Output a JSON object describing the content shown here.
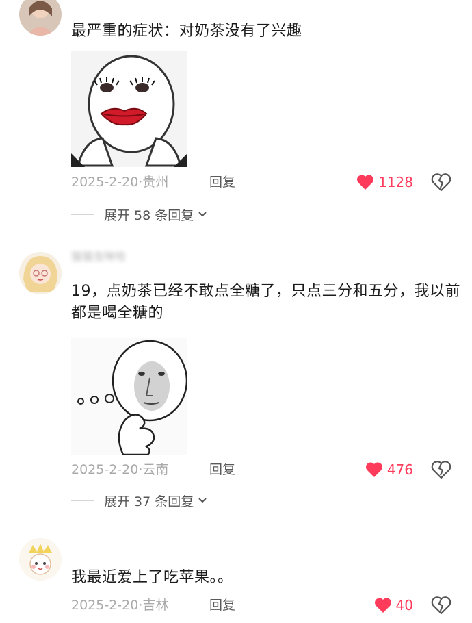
{
  "comments": [
    {
      "text": "最严重的症状：对奶茶没有了兴趣",
      "date": "2025-2-20",
      "location": "贵州",
      "reply_label": "回复",
      "likes": "1128",
      "expand_label": "展开 58 条回复",
      "sticker": "lipstick-face-sticker"
    },
    {
      "username": "猫猫虫咪哈",
      "text": "19，点奶茶已经不敢点全糖了，只点三分和五分，我以前都是喝全糖的",
      "date": "2025-2-20",
      "location": "云南",
      "reply_label": "回复",
      "likes": "476",
      "expand_label": "展开 37 条回复",
      "sticker": "thinking-face-sticker"
    },
    {
      "text": "我最近爱上了吃苹果。。",
      "date": "2025-2-20",
      "location": "吉林",
      "reply_label": "回复",
      "likes": "40"
    }
  ],
  "separator": "·",
  "icons": {
    "like": "heart-filled-icon",
    "dislike": "broken-heart-icon",
    "expand": "chevron-down-icon"
  },
  "colors": {
    "like": "#ff3b5c",
    "meta": "#a9a9a9"
  }
}
